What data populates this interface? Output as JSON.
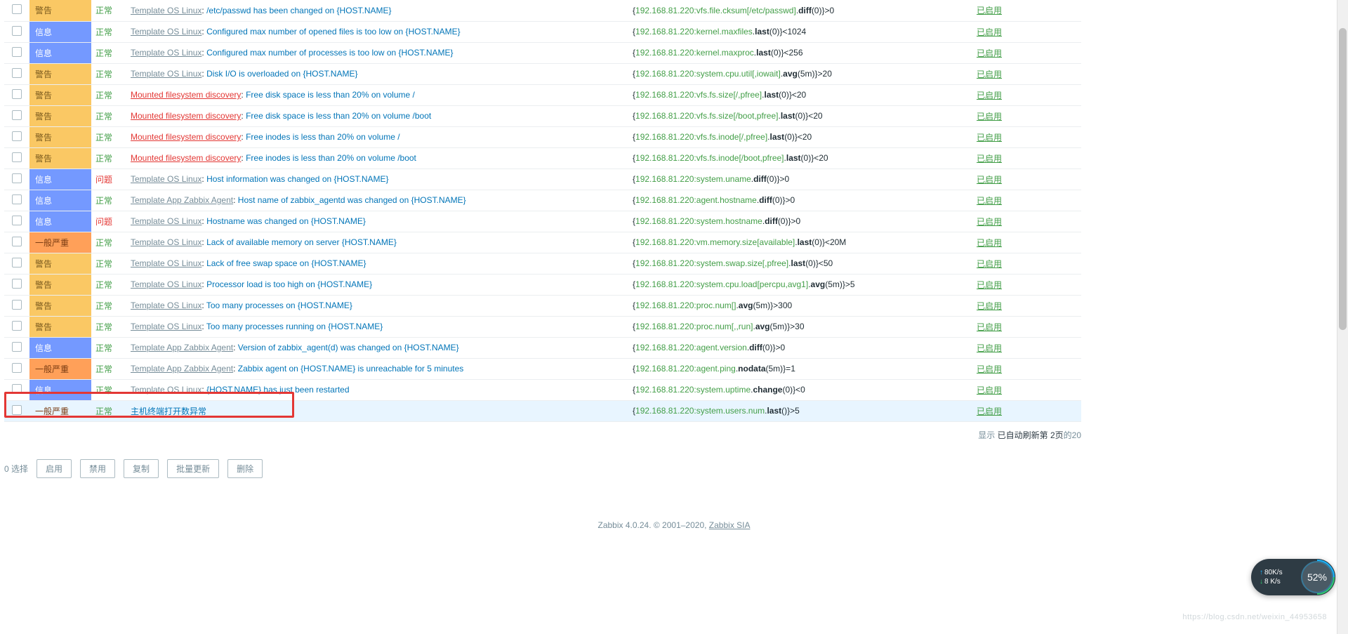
{
  "severity": {
    "warning": "警告",
    "info": "信息",
    "average": "一般严重"
  },
  "state": {
    "ok": "正常",
    "problem": "问题"
  },
  "enabled_label": "已启用",
  "rows": [
    {
      "sev": "warning",
      "state": "ok",
      "src_type": "u",
      "src": "Template OS Linux",
      "name": "/etc/passwd has been changed on {HOST.NAME}",
      "expr_pre": "{",
      "key": "192.168.81.220:vfs.file.cksum[/etc/passwd]",
      "fn": ".diff(0)}>0"
    },
    {
      "sev": "info",
      "state": "ok",
      "src_type": "u",
      "src": "Template OS Linux",
      "name": "Configured max number of opened files is too low on {HOST.NAME}",
      "expr_pre": "{",
      "key": "192.168.81.220:kernel.maxfiles",
      "fn": ".last(0)}<1024"
    },
    {
      "sev": "info",
      "state": "ok",
      "src_type": "u",
      "src": "Template OS Linux",
      "name": "Configured max number of processes is too low on {HOST.NAME}",
      "expr_pre": "{",
      "key": "192.168.81.220:kernel.maxproc",
      "fn": ".last(0)}<256"
    },
    {
      "sev": "warning",
      "state": "ok",
      "src_type": "u",
      "src": "Template OS Linux",
      "name": "Disk I/O is overloaded on {HOST.NAME}",
      "expr_pre": "{",
      "key": "192.168.81.220:system.cpu.util[,iowait]",
      "fn": ".avg(5m)}>20"
    },
    {
      "sev": "warning",
      "state": "ok",
      "src_type": "r",
      "src": "Mounted filesystem discovery",
      "name": "Free disk space is less than 20% on volume /",
      "expr_pre": "{",
      "key": "192.168.81.220:vfs.fs.size[/,pfree]",
      "fn": ".last(0)}<20"
    },
    {
      "sev": "warning",
      "state": "ok",
      "src_type": "r",
      "src": "Mounted filesystem discovery",
      "name": "Free disk space is less than 20% on volume /boot",
      "expr_pre": "{",
      "key": "192.168.81.220:vfs.fs.size[/boot,pfree]",
      "fn": ".last(0)}<20"
    },
    {
      "sev": "warning",
      "state": "ok",
      "src_type": "r",
      "src": "Mounted filesystem discovery",
      "name": "Free inodes is less than 20% on volume /",
      "expr_pre": "{",
      "key": "192.168.81.220:vfs.fs.inode[/,pfree]",
      "fn": ".last(0)}<20"
    },
    {
      "sev": "warning",
      "state": "ok",
      "src_type": "r",
      "src": "Mounted filesystem discovery",
      "name": "Free inodes is less than 20% on volume /boot",
      "expr_pre": "{",
      "key": "192.168.81.220:vfs.fs.inode[/boot,pfree]",
      "fn": ".last(0)}<20"
    },
    {
      "sev": "info",
      "state": "problem",
      "src_type": "u",
      "src": "Template OS Linux",
      "name": "Host information was changed on {HOST.NAME}",
      "expr_pre": "{",
      "key": "192.168.81.220:system.uname",
      "fn": ".diff(0)}>0"
    },
    {
      "sev": "info",
      "state": "ok",
      "src_type": "u",
      "src": "Template App Zabbix Agent",
      "name": "Host name of zabbix_agentd was changed on {HOST.NAME}",
      "expr_pre": "{",
      "key": "192.168.81.220:agent.hostname",
      "fn": ".diff(0)}>0"
    },
    {
      "sev": "info",
      "state": "problem",
      "src_type": "u",
      "src": "Template OS Linux",
      "name": "Hostname was changed on {HOST.NAME}",
      "expr_pre": "{",
      "key": "192.168.81.220:system.hostname",
      "fn": ".diff(0)}>0"
    },
    {
      "sev": "average",
      "state": "ok",
      "src_type": "u",
      "src": "Template OS Linux",
      "name": "Lack of available memory on server {HOST.NAME}",
      "expr_pre": "{",
      "key": "192.168.81.220:vm.memory.size[available]",
      "fn": ".last(0)}<20M"
    },
    {
      "sev": "warning",
      "state": "ok",
      "src_type": "u",
      "src": "Template OS Linux",
      "name": "Lack of free swap space on {HOST.NAME}",
      "expr_pre": "{",
      "key": "192.168.81.220:system.swap.size[,pfree]",
      "fn": ".last(0)}<50"
    },
    {
      "sev": "warning",
      "state": "ok",
      "src_type": "u",
      "src": "Template OS Linux",
      "name": "Processor load is too high on {HOST.NAME}",
      "expr_pre": "{",
      "key": "192.168.81.220:system.cpu.load[percpu,avg1]",
      "fn": ".avg(5m)}>5"
    },
    {
      "sev": "warning",
      "state": "ok",
      "src_type": "u",
      "src": "Template OS Linux",
      "name": "Too many processes on {HOST.NAME}",
      "expr_pre": "{",
      "key": "192.168.81.220:proc.num[]",
      "fn": ".avg(5m)}>300"
    },
    {
      "sev": "warning",
      "state": "ok",
      "src_type": "u",
      "src": "Template OS Linux",
      "name": "Too many processes running on {HOST.NAME}",
      "expr_pre": "{",
      "key": "192.168.81.220:proc.num[,,run]",
      "fn": ".avg(5m)}>30"
    },
    {
      "sev": "info",
      "state": "ok",
      "src_type": "u",
      "src": "Template App Zabbix Agent",
      "name": "Version of zabbix_agent(d) was changed on {HOST.NAME}",
      "expr_pre": "{",
      "key": "192.168.81.220:agent.version",
      "fn": ".diff(0)}>0"
    },
    {
      "sev": "average",
      "state": "ok",
      "src_type": "u",
      "src": "Template App Zabbix Agent",
      "name": "Zabbix agent on {HOST.NAME} is unreachable for 5 minutes",
      "expr_pre": "{",
      "key": "192.168.81.220:agent.ping",
      "fn": ".nodata(5m)}=1"
    },
    {
      "sev": "info",
      "state": "ok",
      "src_type": "u",
      "src": "Template OS Linux",
      "name": "{HOST.NAME} has just been restarted",
      "expr_pre": "{",
      "key": "192.168.81.220:system.uptime",
      "fn": ".change(0)}<0"
    },
    {
      "sev": "average",
      "state": "ok",
      "src_type": "",
      "src": "",
      "name": "主机终端打开数异常",
      "expr_pre": "{",
      "key": "192.168.81.220:system.users.num",
      "fn": ".last()}>5",
      "highlight": true
    }
  ],
  "summary_suffix": "的20",
  "summary_prefix": "显示 ",
  "selection": {
    "label": "0 选择"
  },
  "buttons": {
    "enable": "启用",
    "disable": "禁用",
    "copy": "复制",
    "massupdate": "批量更新",
    "delete": "删除"
  },
  "footer": {
    "version": "Zabbix 4.0.24. © 2001–2020, ",
    "company": "Zabbix SIA"
  },
  "net": {
    "up": "80K/s",
    "down": "8 K/s",
    "gauge": "52%"
  },
  "watermark": "https://blog.csdn.net/weixin_44953658"
}
